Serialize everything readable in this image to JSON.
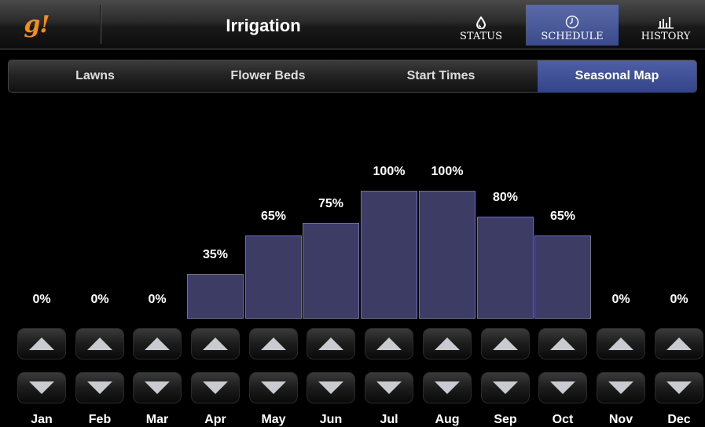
{
  "header": {
    "logo": "g!",
    "title": "Irrigation",
    "nav": [
      {
        "label": "STATUS",
        "icon": "water-drop-icon"
      },
      {
        "label": "SCHEDULE",
        "icon": "clock-icon",
        "active": true
      },
      {
        "label": "HISTORY",
        "icon": "bar-chart-icon"
      }
    ]
  },
  "tabs": [
    {
      "label": "Lawns"
    },
    {
      "label": "Flower Beds"
    },
    {
      "label": "Start Times"
    },
    {
      "label": "Seasonal Map",
      "active": true
    }
  ],
  "colors": {
    "accent": "#3b4a8c",
    "bar_fill": "#3d3c64",
    "bar_border": "#6d6cb0",
    "logo": "#f0901a"
  },
  "chart_data": {
    "type": "bar",
    "categories": [
      "Jan",
      "Feb",
      "Mar",
      "Apr",
      "May",
      "Jun",
      "Jul",
      "Aug",
      "Sep",
      "Oct",
      "Nov",
      "Dec"
    ],
    "values": [
      0,
      0,
      0,
      35,
      65,
      75,
      100,
      100,
      80,
      65,
      0,
      0
    ],
    "value_labels": [
      "0%",
      "0%",
      "0%",
      "35%",
      "65%",
      "75%",
      "100%",
      "100%",
      "80%",
      "65%",
      "0%",
      "0%"
    ],
    "ylim": [
      0,
      100
    ]
  }
}
